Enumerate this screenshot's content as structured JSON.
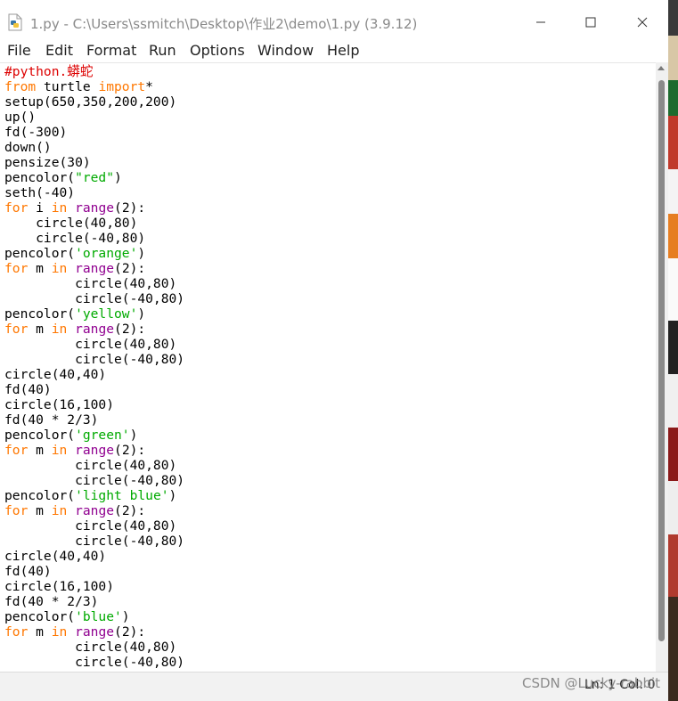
{
  "window": {
    "title": "1.py - C:\\Users\\ssmitch\\Desktop\\作业2\\demo\\1.py (3.9.12)",
    "min_label": "—",
    "max_label": "☐",
    "close_label": "✕"
  },
  "menu": [
    "File",
    "Edit",
    "Format",
    "Run",
    "Options",
    "Window",
    "Help"
  ],
  "code_lines": [
    [
      {
        "t": "#python.蟒蛇",
        "c": "cm"
      }
    ],
    [
      {
        "t": "from",
        "c": "kw"
      },
      {
        "t": " turtle ",
        "c": ""
      },
      {
        "t": "import",
        "c": "kw"
      },
      {
        "t": "*",
        "c": ""
      }
    ],
    [
      {
        "t": "setup(650,350,200,200)",
        "c": ""
      }
    ],
    [
      {
        "t": "up()",
        "c": ""
      }
    ],
    [
      {
        "t": "fd(-300)",
        "c": ""
      }
    ],
    [
      {
        "t": "down()",
        "c": ""
      }
    ],
    [
      {
        "t": "pensize(30)",
        "c": ""
      }
    ],
    [
      {
        "t": "pencolor(",
        "c": ""
      },
      {
        "t": "\"red\"",
        "c": "str"
      },
      {
        "t": ")",
        "c": ""
      }
    ],
    [
      {
        "t": "seth(-40)",
        "c": ""
      }
    ],
    [
      {
        "t": "for",
        "c": "kw"
      },
      {
        "t": " i ",
        "c": ""
      },
      {
        "t": "in",
        "c": "kw"
      },
      {
        "t": " ",
        "c": ""
      },
      {
        "t": "range",
        "c": "bi"
      },
      {
        "t": "(2):",
        "c": ""
      }
    ],
    [
      {
        "t": "    circle(40,80)",
        "c": ""
      }
    ],
    [
      {
        "t": "    circle(-40,80)",
        "c": ""
      }
    ],
    [
      {
        "t": "pencolor(",
        "c": ""
      },
      {
        "t": "'orange'",
        "c": "str"
      },
      {
        "t": ")",
        "c": ""
      }
    ],
    [
      {
        "t": "for",
        "c": "kw"
      },
      {
        "t": " m ",
        "c": ""
      },
      {
        "t": "in",
        "c": "kw"
      },
      {
        "t": " ",
        "c": ""
      },
      {
        "t": "range",
        "c": "bi"
      },
      {
        "t": "(2):",
        "c": ""
      }
    ],
    [
      {
        "t": "         circle(40,80)",
        "c": ""
      }
    ],
    [
      {
        "t": "         circle(-40,80)",
        "c": ""
      }
    ],
    [
      {
        "t": "pencolor(",
        "c": ""
      },
      {
        "t": "'yellow'",
        "c": "str"
      },
      {
        "t": ")",
        "c": ""
      }
    ],
    [
      {
        "t": "for",
        "c": "kw"
      },
      {
        "t": " m ",
        "c": ""
      },
      {
        "t": "in",
        "c": "kw"
      },
      {
        "t": " ",
        "c": ""
      },
      {
        "t": "range",
        "c": "bi"
      },
      {
        "t": "(2):",
        "c": ""
      }
    ],
    [
      {
        "t": "         circle(40,80)",
        "c": ""
      }
    ],
    [
      {
        "t": "         circle(-40,80)",
        "c": ""
      }
    ],
    [
      {
        "t": "circle(40,40)",
        "c": ""
      }
    ],
    [
      {
        "t": "fd(40)",
        "c": ""
      }
    ],
    [
      {
        "t": "circle(16,100)",
        "c": ""
      }
    ],
    [
      {
        "t": "fd(40 * 2/3)",
        "c": ""
      }
    ],
    [
      {
        "t": "pencolor(",
        "c": ""
      },
      {
        "t": "'green'",
        "c": "str"
      },
      {
        "t": ")",
        "c": ""
      }
    ],
    [
      {
        "t": "for",
        "c": "kw"
      },
      {
        "t": " m ",
        "c": ""
      },
      {
        "t": "in",
        "c": "kw"
      },
      {
        "t": " ",
        "c": ""
      },
      {
        "t": "range",
        "c": "bi"
      },
      {
        "t": "(2):",
        "c": ""
      }
    ],
    [
      {
        "t": "         circle(40,80)",
        "c": ""
      }
    ],
    [
      {
        "t": "         circle(-40,80)",
        "c": ""
      }
    ],
    [
      {
        "t": "pencolor(",
        "c": ""
      },
      {
        "t": "'light blue'",
        "c": "str"
      },
      {
        "t": ")",
        "c": ""
      }
    ],
    [
      {
        "t": "for",
        "c": "kw"
      },
      {
        "t": " m ",
        "c": ""
      },
      {
        "t": "in",
        "c": "kw"
      },
      {
        "t": " ",
        "c": ""
      },
      {
        "t": "range",
        "c": "bi"
      },
      {
        "t": "(2):",
        "c": ""
      }
    ],
    [
      {
        "t": "         circle(40,80)",
        "c": ""
      }
    ],
    [
      {
        "t": "         circle(-40,80)",
        "c": ""
      }
    ],
    [
      {
        "t": "circle(40,40)",
        "c": ""
      }
    ],
    [
      {
        "t": "fd(40)",
        "c": ""
      }
    ],
    [
      {
        "t": "circle(16,100)",
        "c": ""
      }
    ],
    [
      {
        "t": "fd(40 * 2/3)",
        "c": ""
      }
    ],
    [
      {
        "t": "pencolor(",
        "c": ""
      },
      {
        "t": "'blue'",
        "c": "str"
      },
      {
        "t": ")",
        "c": ""
      }
    ],
    [
      {
        "t": "for",
        "c": "kw"
      },
      {
        "t": " m ",
        "c": ""
      },
      {
        "t": "in",
        "c": "kw"
      },
      {
        "t": " ",
        "c": ""
      },
      {
        "t": "range",
        "c": "bi"
      },
      {
        "t": "(2):",
        "c": ""
      }
    ],
    [
      {
        "t": "         circle(40,80)",
        "c": ""
      }
    ],
    [
      {
        "t": "         circle(-40,80)",
        "c": ""
      }
    ]
  ],
  "status": {
    "position": "Ln: 1   Col: 0"
  },
  "watermark": "CSDN @Lucky-rabbit",
  "colors": {
    "keyword": "#ff7700",
    "builtin": "#900090",
    "string": "#00aa00",
    "comment": "#dd0000"
  }
}
